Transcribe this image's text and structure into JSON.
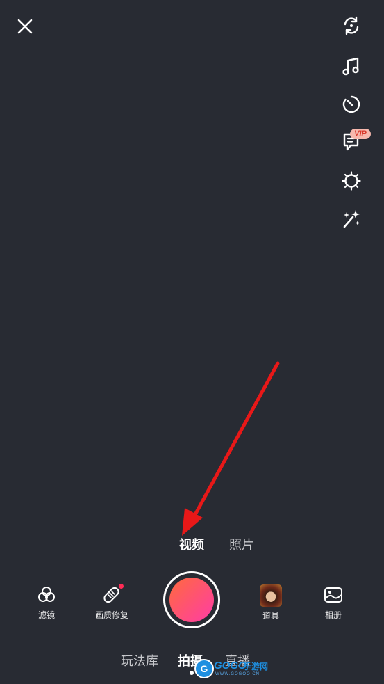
{
  "top": {
    "close_icon": "close-icon",
    "right_icons": [
      "flip-camera-icon",
      "music-icon",
      "timer-icon",
      "subtitle-icon",
      "beauty-icon",
      "magic-wand-icon"
    ],
    "vip_badge": "VIP"
  },
  "capture_modes": {
    "video": "视频",
    "photo": "照片",
    "selected": "video"
  },
  "bottom_bar": {
    "filter_label": "滤镜",
    "enhance_label": "画质修复",
    "props_label": "道具",
    "album_label": "相册"
  },
  "bottom_nav": {
    "library": "玩法库",
    "shoot": "拍摄",
    "live": "直播",
    "selected": "shoot"
  },
  "watermark": {
    "brand": "GOGO",
    "name": "手游网",
    "url": "WWW.GOGOO.CN"
  },
  "colors": {
    "background": "#282b33",
    "record_gradient_start": "#ff6a3d",
    "record_gradient_end": "#ff3ca6",
    "annotation_arrow": "#e81818",
    "vip_badge": "#f7b8ad"
  }
}
